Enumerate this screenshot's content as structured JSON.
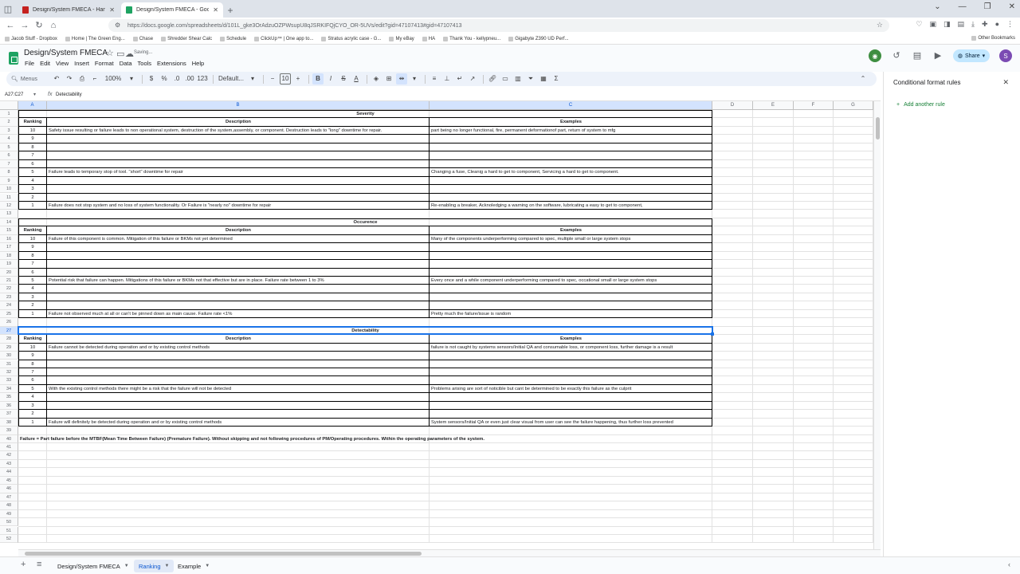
{
  "browser": {
    "tabs": [
      {
        "title": "Design/System FMECA - Hand",
        "favicon_color": "#c5221f",
        "active": false
      },
      {
        "title": "Design/System FMECA - Googl",
        "favicon_color": "#1ea362",
        "active": true
      }
    ],
    "url": "https://docs.google.com/spreadsheets/d/101L_gke3OrAdzuOZPWsupU8qJSRKIFQjCYO_OR-5UVs/edit?gid=47107413#gid=47107413",
    "bookmarks": [
      "Jacob Stuff - Dropbox",
      "Home | The Green Eng...",
      "Chase",
      "Shredder Shear Calc",
      "Schedule",
      "ClickUp™ | One app to...",
      "Stratus acrylic case - G...",
      "My eBay",
      "HA",
      "Thank You - kellypneu...",
      "Gigabyte Z390 UD Perf..."
    ],
    "other_bookmarks": "Other Bookmarks"
  },
  "doc": {
    "title": "Design/System FMECA",
    "status": "Saving...",
    "menus": [
      "File",
      "Edit",
      "View",
      "Insert",
      "Format",
      "Data",
      "Tools",
      "Extensions",
      "Help"
    ],
    "share_label": "Share",
    "avatar_letter": "S"
  },
  "toolbar": {
    "menus_search": "Menus",
    "zoom": "100%",
    "currency": "$",
    "percent": "%",
    "dec_less": ".0",
    "dec_more": ".00",
    "number_format": "123",
    "font": "Default...",
    "font_size": "10"
  },
  "formula_bar": {
    "name_box": "A27:C27",
    "value": "Detectability"
  },
  "columns": [
    {
      "label": "A",
      "selected": true
    },
    {
      "label": "B",
      "selected": true
    },
    {
      "label": "C",
      "selected": true
    },
    {
      "label": "D",
      "selected": false
    },
    {
      "label": "E",
      "selected": false
    },
    {
      "label": "F",
      "selected": false
    },
    {
      "label": "G",
      "selected": false
    }
  ],
  "selected_row": 27,
  "cells": {
    "1": {
      "merged": "Severity"
    },
    "2": {
      "A": "Ranking",
      "B": "Description",
      "C": "Examples"
    },
    "3": {
      "A": "10",
      "B": "Safety issue resulting or failure leads to non operational system, destruction of the system,assembly, or component. Destruction leads to \"long\" downtime for repair.",
      "C": "part being no longer functional, fire, permanent deformationof part, return of system to mfg"
    },
    "4": {
      "A": "9"
    },
    "5": {
      "A": "8"
    },
    "6": {
      "A": "7"
    },
    "7": {
      "A": "6"
    },
    "8": {
      "A": "5",
      "B": "Failure leads to temporary stop of tool. \"short\" downtime for repair",
      "C": "Changing a fuse, Cleanig a hard to get to component, Servicing a hard to get to component."
    },
    "9": {
      "A": "4"
    },
    "10": {
      "A": "3"
    },
    "11": {
      "A": "2"
    },
    "12": {
      "A": "1",
      "B": "Failure does not stop system and no loss of system functionality. Or Failure is \"nearly no\" downtime for repair",
      "C": "Re-enabling a breaker, Acknoledging a warning on the software, lubricating a easy to get to component,"
    },
    "14": {
      "merged": "Occurence"
    },
    "15": {
      "A": "Ranking",
      "B": "Description",
      "C": "Examples"
    },
    "16": {
      "A": "10",
      "B": "Failure of this component is common. Mitigation of this failure or BKMs not yet determined",
      "C": "Many of the components underperforming compared to spec, multiple small or large system stops"
    },
    "17": {
      "A": "9"
    },
    "18": {
      "A": "8"
    },
    "19": {
      "A": "7"
    },
    "20": {
      "A": "6"
    },
    "21": {
      "A": "5",
      "B": "Potential risk that failure can happen. Mitigations of this failure or BKMs not that effective but are in place. Failure rate between 1 to 3%",
      "C": "Every once and a while component underperforming compared to spec, occational small or large system stops"
    },
    "22": {
      "A": "4"
    },
    "23": {
      "A": "3"
    },
    "24": {
      "A": "2"
    },
    "25": {
      "A": "1",
      "B": "Failure not observed much at all or can't be pinned down as main cause. Failure rate <1%",
      "C": "Pretty much the failure/issue is random"
    },
    "27": {
      "merged": "Detectability"
    },
    "28": {
      "A": "Ranking",
      "B": "Description",
      "C": "Examples"
    },
    "29": {
      "A": "10",
      "B": "Failure cannot be detected during operation and or by existing control methods",
      "C": "failure is not caught by systems sensors/Initial QA and consumable loss, or component loss, further damage is a result"
    },
    "30": {
      "A": "9"
    },
    "31": {
      "A": "8"
    },
    "32": {
      "A": "7"
    },
    "33": {
      "A": "6"
    },
    "34": {
      "A": "5",
      "B": "With the existing control methods there might be a risk that the failure will not be detected",
      "C": "Problems arising are sort of noticible but cant be determined to be exactly this failure as the culprit"
    },
    "35": {
      "A": "4"
    },
    "36": {
      "A": "3"
    },
    "37": {
      "A": "2"
    },
    "38": {
      "A": "1",
      "B": "Failure will definitely be detected during operation and or by existing control methods",
      "C": "System sensors/Initial QA or even just clear visual from user can see the failure happening, thus further loss prevented"
    },
    "40": {
      "note": "Failure = Part failure before the MTBF(Mean Time Between Failure) (Premature Failure). Without skipping and not following procedures of PM/Operating procedures. Within the operating parameters of the system."
    }
  },
  "side_panel": {
    "title": "Conditional format rules",
    "add_rule": "Add another rule"
  },
  "sheet_tabs": [
    {
      "label": "Design/System FMECA",
      "active": false
    },
    {
      "label": "Ranking",
      "active": true
    },
    {
      "label": "Example",
      "active": false
    }
  ],
  "colors": {
    "accent": "#1a73e8",
    "sheets_green": "#1ea362",
    "selection": "#d3e3fd"
  }
}
